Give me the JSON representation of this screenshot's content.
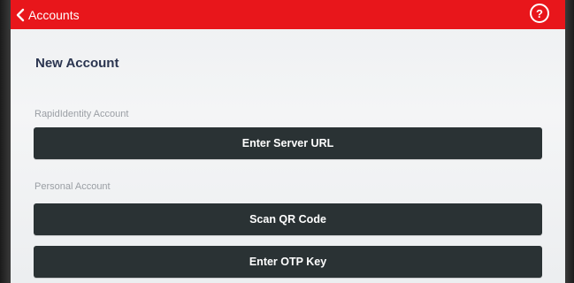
{
  "header": {
    "back_label": "Accounts",
    "help_icon": "help-circle-icon",
    "back_icon": "chevron-left-icon",
    "color": "#e8161b"
  },
  "page": {
    "title": "New Account"
  },
  "sections": {
    "rapididentity": {
      "label": "RapidIdentity Account",
      "button_label": "Enter Server URL"
    },
    "personal": {
      "label": "Personal Account",
      "scan_label": "Scan QR Code",
      "otp_label": "Enter OTP Key"
    }
  },
  "colors": {
    "button_bg": "#2a3234",
    "title": "#2b3550",
    "section_label": "#9a9ea4"
  }
}
